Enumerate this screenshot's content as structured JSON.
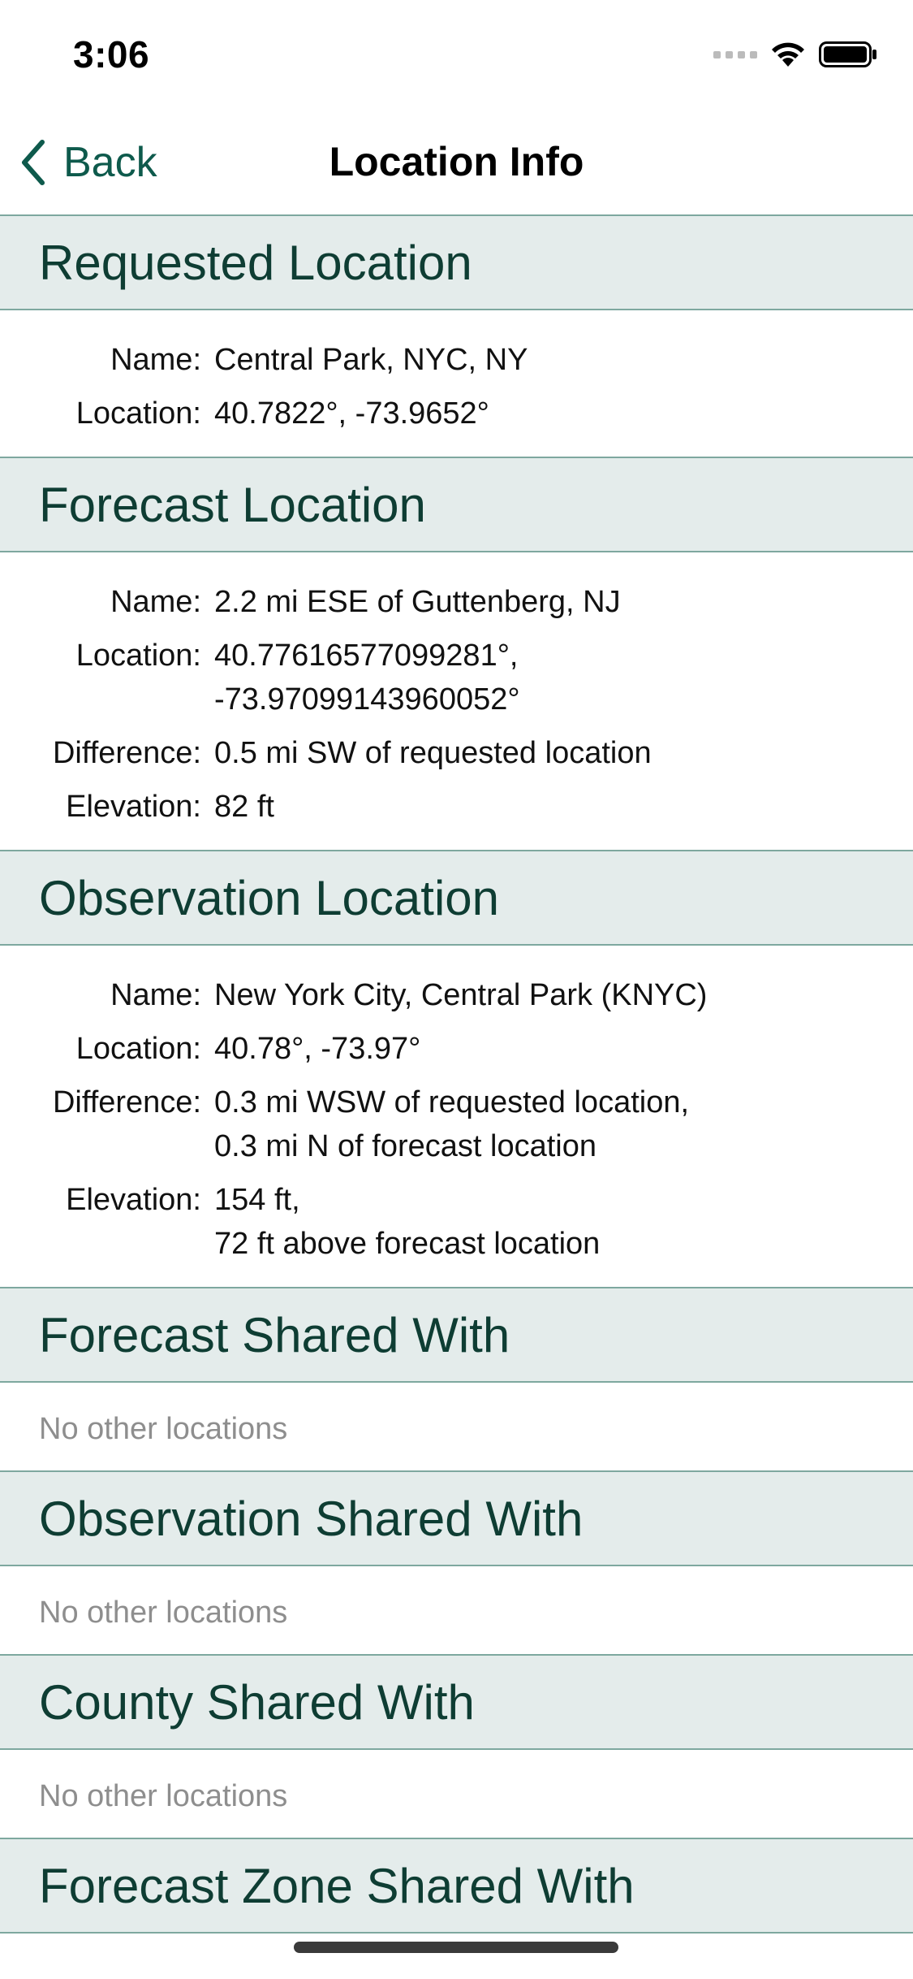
{
  "status_bar": {
    "time": "3:06"
  },
  "nav": {
    "back_label": "Back",
    "title": "Location Info"
  },
  "colors": {
    "accent": "#0e5a4c",
    "header_bg": "#e4eceb",
    "header_border": "#7ea89f",
    "header_text": "#0e3d33",
    "muted_text": "#8e8e8e"
  },
  "sections": {
    "requested": {
      "header": "Requested Location",
      "name_label": "Name:",
      "name_value": "Central Park, NYC, NY",
      "location_label": "Location:",
      "location_value": "40.7822°, -73.9652°"
    },
    "forecast": {
      "header": "Forecast Location",
      "name_label": "Name:",
      "name_value": "2.2 mi ESE of Guttenberg, NJ",
      "location_label": "Location:",
      "location_value": "40.77616577099281°,\n-73.97099143960052°",
      "difference_label": "Difference:",
      "difference_value": "0.5 mi SW of requested location",
      "elevation_label": "Elevation:",
      "elevation_value": "82 ft"
    },
    "observation": {
      "header": "Observation Location",
      "name_label": "Name:",
      "name_value": "New York City, Central Park (KNYC)",
      "location_label": "Location:",
      "location_value": "40.78°, -73.97°",
      "difference_label": "Difference:",
      "difference_value": "0.3 mi WSW of requested location,\n0.3 mi N of forecast location",
      "elevation_label": "Elevation:",
      "elevation_value": "154 ft,\n72 ft above forecast location"
    },
    "forecast_shared": {
      "header": "Forecast Shared With",
      "empty": "No other locations"
    },
    "observation_shared": {
      "header": "Observation Shared With",
      "empty": "No other locations"
    },
    "county_shared": {
      "header": "County Shared With",
      "empty": "No other locations"
    },
    "forecast_zone_shared": {
      "header": "Forecast Zone Shared With"
    }
  }
}
